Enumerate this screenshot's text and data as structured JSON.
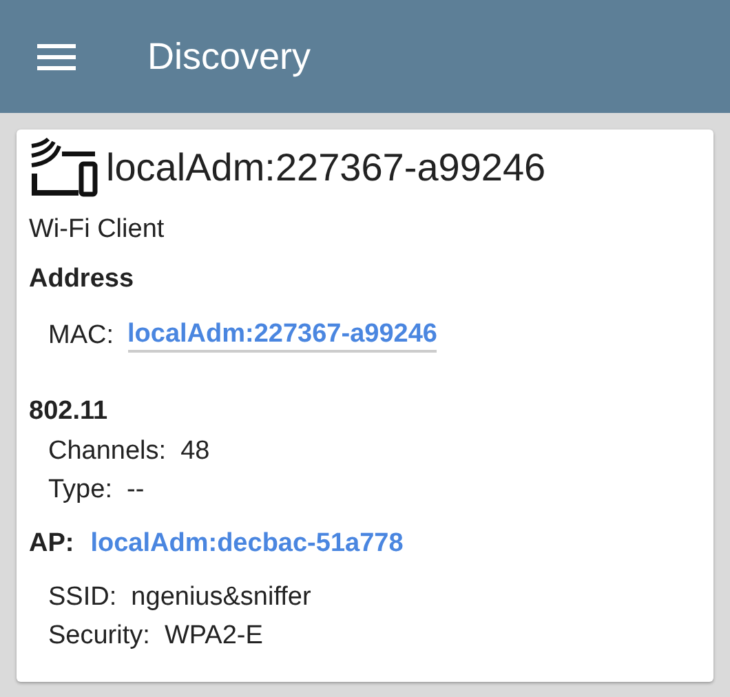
{
  "app_bar": {
    "title": "Discovery"
  },
  "device": {
    "name": "localAdm:227367-a99246",
    "type": "Wi-Fi Client"
  },
  "sections": [
    {
      "heading": "Address",
      "fields": [
        {
          "kind": "link",
          "label": "MAC:",
          "value": "localAdm:227367-a99246"
        }
      ]
    },
    {
      "heading": "802.11",
      "fields": [
        {
          "kind": "text",
          "text": "Channels:  48"
        },
        {
          "kind": "text",
          "text": "Type:  --"
        }
      ]
    },
    {
      "heading": "AP:",
      "heading_link": "localAdm:decbac-51a778",
      "fields": [
        {
          "kind": "text",
          "text": "SSID:  ngenius&sniffer"
        },
        {
          "kind": "text",
          "text": "Security:  WPA2-E"
        }
      ]
    }
  ]
}
